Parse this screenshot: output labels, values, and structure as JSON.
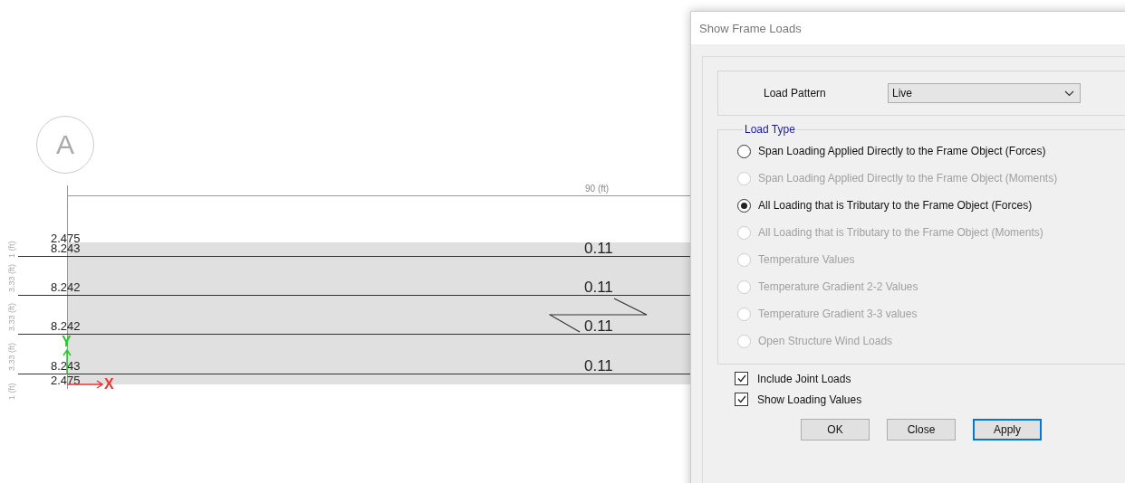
{
  "canvas": {
    "grid_bubble": "A",
    "span_dimension": "90 (ft)",
    "beams": [
      {
        "load": "0.11",
        "end_value": "8.243"
      },
      {
        "load": "0.11",
        "end_value": "8.242"
      },
      {
        "load": "0.11",
        "end_value": "8.242"
      },
      {
        "load": "0.11",
        "end_value": "8.243"
      }
    ],
    "edge_values": [
      "2.475",
      "2.475"
    ],
    "spacing_dimensions": [
      "1 (ft)",
      "3.33 (ft)",
      "3.33 (ft)",
      "3.33 (ft)",
      "1 (ft)"
    ],
    "axes": {
      "x": "X",
      "y": "Y"
    }
  },
  "dialog": {
    "title": "Show Frame Loads",
    "load_pattern": {
      "label": "Load Pattern",
      "value": "Live"
    },
    "load_type": {
      "legend": "Load Type",
      "options": [
        {
          "label": "Span Loading Applied Directly to the Frame Object (Forces)",
          "selected": false,
          "disabled": false
        },
        {
          "label": "Span Loading Applied Directly to the Frame Object (Moments)",
          "selected": false,
          "disabled": true
        },
        {
          "label": "All Loading that is Tributary to the Frame Object (Forces)",
          "selected": true,
          "disabled": false
        },
        {
          "label": "All Loading that is Tributary to the Frame Object (Moments)",
          "selected": false,
          "disabled": true
        },
        {
          "label": "Temperature Values",
          "selected": false,
          "disabled": true
        },
        {
          "label": "Temperature Gradient 2-2 Values",
          "selected": false,
          "disabled": true
        },
        {
          "label": "Temperature Gradient 3-3 values",
          "selected": false,
          "disabled": true
        },
        {
          "label": "Open Structure Wind Loads",
          "selected": false,
          "disabled": true
        }
      ]
    },
    "checkboxes": [
      {
        "label": "Include Joint Loads",
        "checked": true
      },
      {
        "label": "Show Loading Values",
        "checked": true
      }
    ],
    "buttons": [
      {
        "label": "OK",
        "focused": false
      },
      {
        "label": "Close",
        "focused": false
      },
      {
        "label": "Apply",
        "focused": true
      }
    ]
  }
}
